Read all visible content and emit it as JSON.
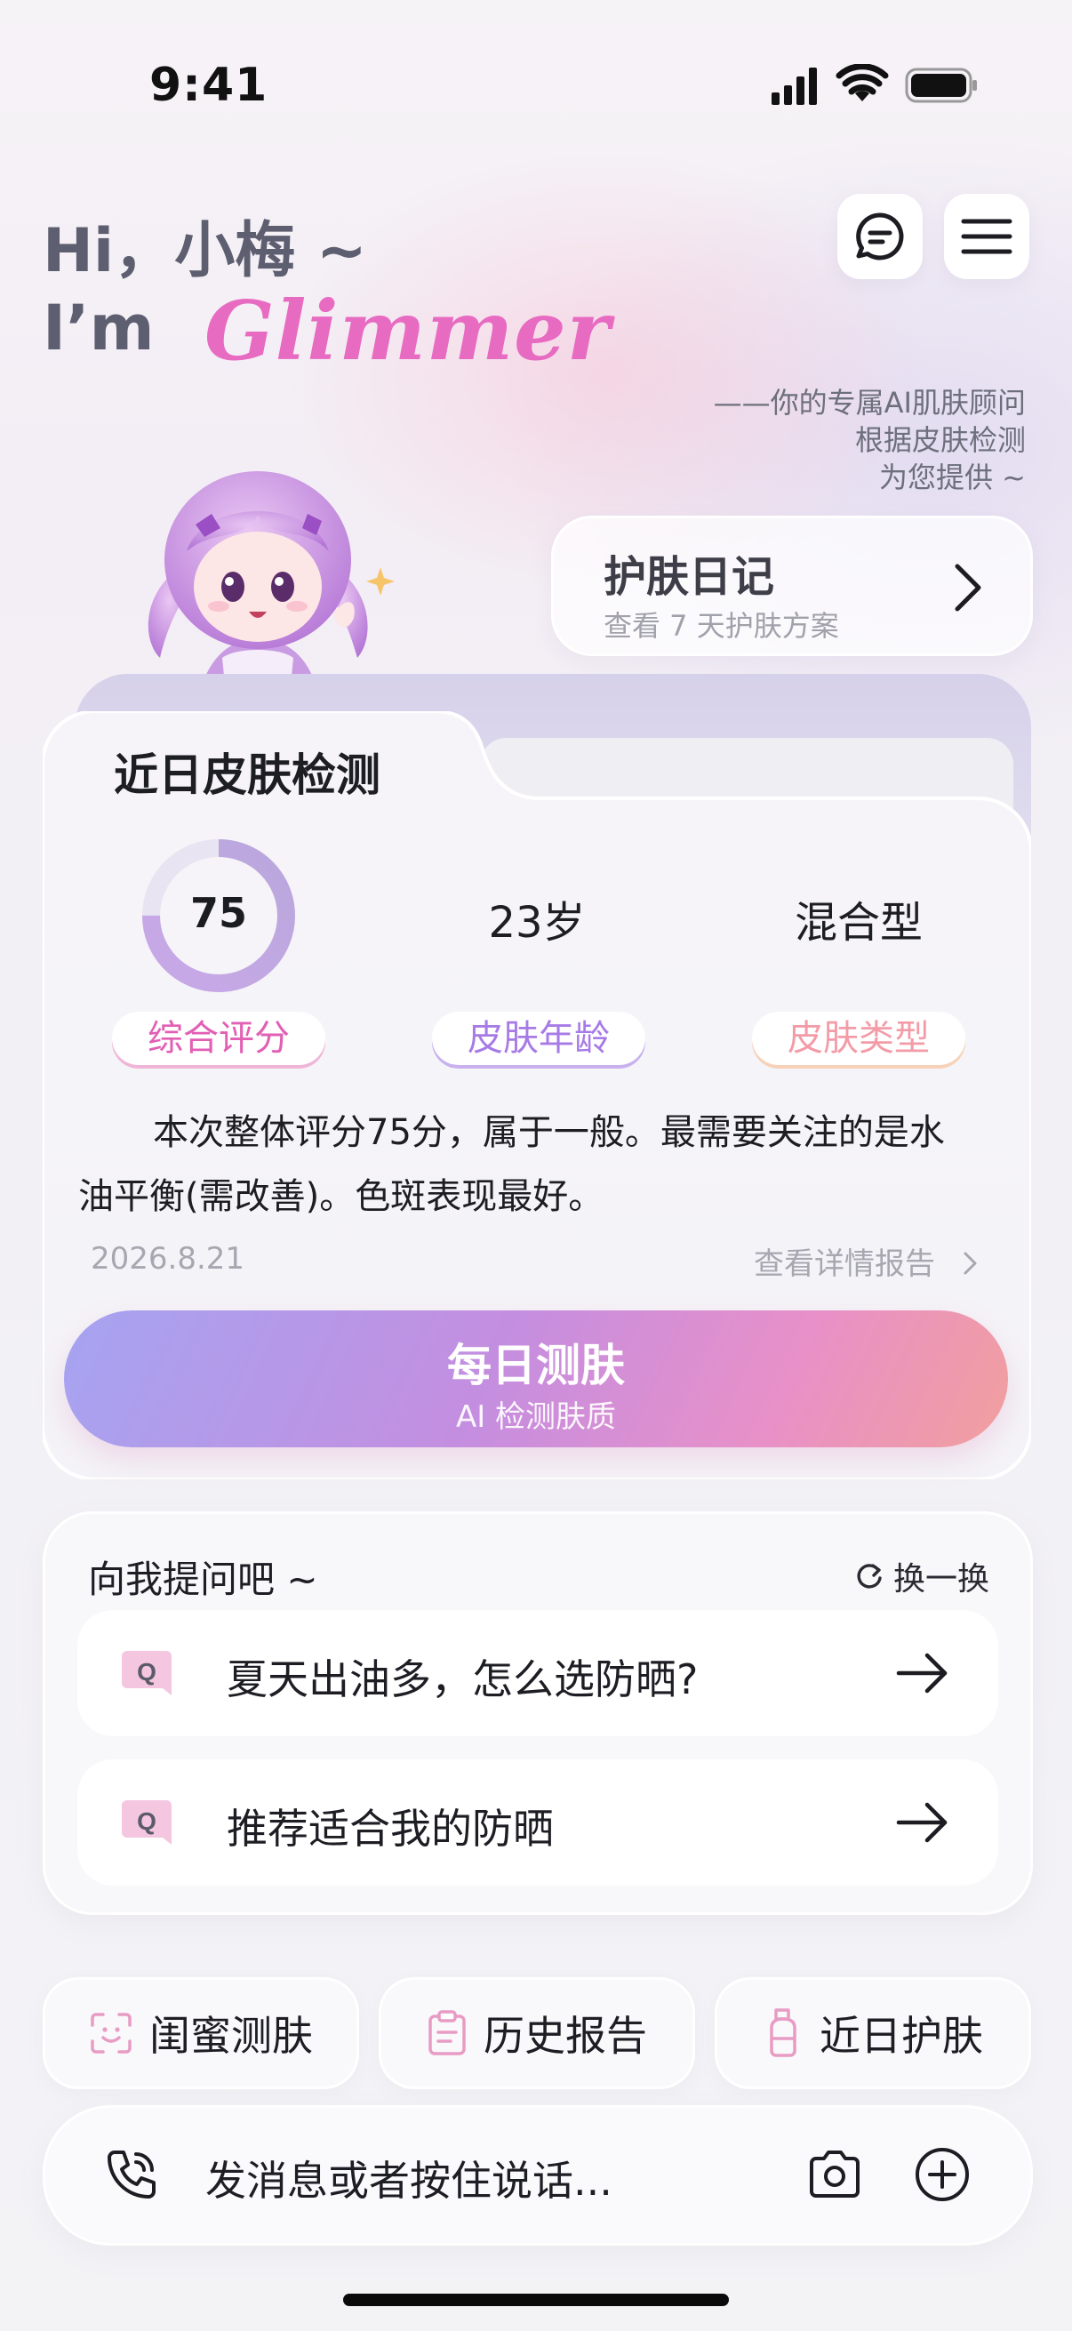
{
  "status_bar": {
    "time": "9:41"
  },
  "greeting": {
    "line1": "Hi，小梅 ~",
    "line2_prefix": "I’m",
    "brand": "Glimmer",
    "tagline": [
      "——你的专属AI肌肤顾问",
      "根据皮肤检测",
      "为您提供 ~"
    ]
  },
  "diary": {
    "title": "护肤日记",
    "subtitle": "查看 7 天护肤方案"
  },
  "detection_card": {
    "title": "近日皮肤检测",
    "score": {
      "value": "75",
      "progress": 0.75,
      "label": "综合评分"
    },
    "skin_age": {
      "value": "23岁",
      "label": "皮肤年龄"
    },
    "skin_type": {
      "value": "混合型",
      "label": "皮肤类型"
    },
    "summary_part1": "本次整体评分75分，属于一般。最需要关注的是水",
    "summary_part2": "油平衡(需改善)。色斑表现最好。",
    "date": "2026.8.21",
    "report_link": "查看详情报告"
  },
  "daily_test_button": {
    "title": "每日测肤",
    "subtitle": "AI 检测肤质"
  },
  "ask": {
    "title": "向我提问吧 ~",
    "refresh_label": "换一换",
    "badge": "Q",
    "questions": [
      "夏天出油多，怎么选防晒?",
      "推荐适合我的防晒"
    ]
  },
  "quick_actions": [
    {
      "label": "闺蜜测肤",
      "icon": "face-scan-icon"
    },
    {
      "label": "历史报告",
      "icon": "clipboard-icon"
    },
    {
      "label": "近日护肤",
      "icon": "bottle-icon"
    }
  ],
  "input": {
    "placeholder": "发消息或者按住说话..."
  },
  "colors": {
    "brand_pink": "#e86bc2",
    "score_label": "#e25fb4",
    "age_label": "#a77be6",
    "type_label": "#f39ca8",
    "button_gradient": [
      "#a5a4f1",
      "#e890c8",
      "#f19f9e"
    ]
  }
}
